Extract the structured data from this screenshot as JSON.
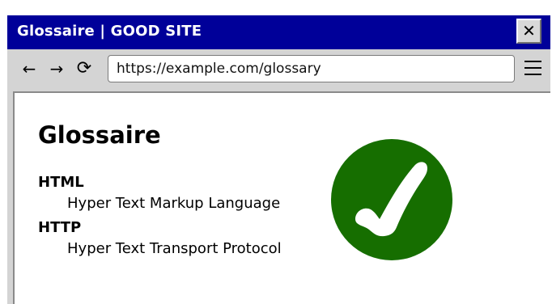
{
  "window": {
    "title": "Glossaire | GOOD SITE",
    "close_label": "✕"
  },
  "toolbar": {
    "back_label": "←",
    "forward_label": "→",
    "reload_label": "⟳",
    "url": "https://example.com/glossary",
    "menu_icon": "hamburger-menu-icon"
  },
  "page": {
    "heading": "Glossaire",
    "terms": [
      {
        "term": "HTML",
        "definition": "Hyper Text Markup Language"
      },
      {
        "term": "HTTP",
        "definition": "Hyper Text Transport Protocol"
      }
    ],
    "badge_icon": "checkmark-icon",
    "badge_color": "#166e00"
  },
  "colors": {
    "titlebar": "#000099",
    "chrome": "#d4d4d4"
  }
}
